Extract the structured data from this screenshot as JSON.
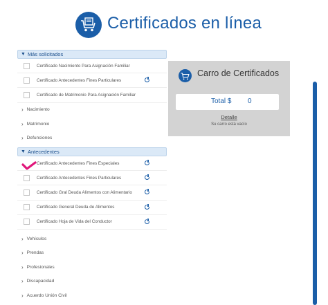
{
  "header": {
    "title": "Certificados en línea",
    "logo_icon": "cart-certificate-icon"
  },
  "sections": {
    "mas_solicitados": {
      "label": "Más solicitados",
      "items": [
        {
          "label": "Certificado Nacimiento Para Asignación Familiar",
          "info": false
        },
        {
          "label": "Certificado Antecedentes Fines Particulares",
          "info": true
        },
        {
          "label": "Certificado de Matrimonio Para Asignación Familiar",
          "info": false
        }
      ]
    },
    "categories_top": [
      "Nacimiento",
      "Matrimonio",
      "Defunciones"
    ],
    "antecedentes": {
      "label": "Antecedentes",
      "items": [
        {
          "label": "Certificado Antecedentes Fines Especiales",
          "info": true,
          "checked": true
        },
        {
          "label": "Certificado Antecedentes Fines Particulares",
          "info": true
        },
        {
          "label": "Certificado Gral Deuda Alimentos con Alimentario",
          "info": true
        },
        {
          "label": "Certificado General Deuda de Alimentos",
          "info": true
        },
        {
          "label": "Certificado Hoja de Vida del Conductor",
          "info": true
        }
      ]
    },
    "categories_bottom": [
      "Vehículos",
      "Prendas",
      "Profesionales",
      "Discapacidad",
      "Acuerdo Unión Civil"
    ]
  },
  "cart": {
    "title": "Carro de Certificados",
    "total_label": "Total $",
    "total_value": "0",
    "detail_link": "Detalle",
    "empty_text": "Su carro está vacío"
  },
  "colors": {
    "brand": "#1b5ea8",
    "check": "#e0167a",
    "cart_bg": "#d3d3d3"
  }
}
